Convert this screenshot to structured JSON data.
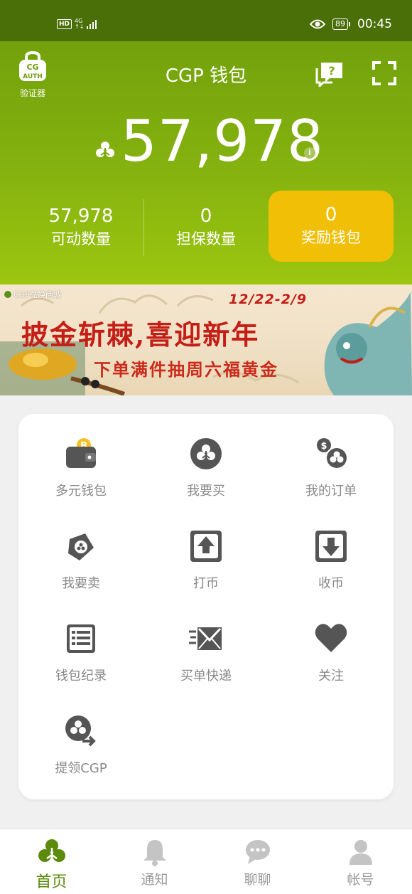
{
  "status_bar": {
    "hd": "HD",
    "network": "4G",
    "network_sub": "↑↓",
    "battery": "89",
    "time": "00:45"
  },
  "header": {
    "auth_label": "验证器",
    "auth_logo_text": "CG AUTH",
    "title": "CGP 钱包",
    "help_icon_text": "?",
    "balance": "57,978",
    "info_icon_text": "i",
    "stats": [
      {
        "value": "57,978",
        "label": "可动数量"
      },
      {
        "value": "0",
        "label": "担保数量"
      }
    ],
    "reward": {
      "value": "0",
      "label": "奖励钱包"
    },
    "colors": {
      "top": "#72a10c",
      "bottom": "#9cc60f",
      "reward": "#f2bf07"
    }
  },
  "banner": {
    "brand": "CGP兑换商城",
    "date_range": "12/22-2/9",
    "headline": "披金斩棘,喜迎新年",
    "subline": "下单满件抽周六福黄金"
  },
  "menu": {
    "items": [
      {
        "label": "多元钱包",
        "icon": "multi-wallet-icon"
      },
      {
        "label": "我要买",
        "icon": "buy-icon"
      },
      {
        "label": "我的订单",
        "icon": "orders-icon"
      },
      {
        "label": "我要卖",
        "icon": "sell-icon"
      },
      {
        "label": "打币",
        "icon": "send-coin-icon"
      },
      {
        "label": "收币",
        "icon": "receive-coin-icon"
      },
      {
        "label": "钱包纪录",
        "icon": "wallet-record-icon"
      },
      {
        "label": "买单快递",
        "icon": "express-mail-icon"
      },
      {
        "label": "关注",
        "icon": "heart-icon"
      },
      {
        "label": "提领CGP",
        "icon": "withdraw-icon"
      }
    ]
  },
  "tabs": [
    {
      "label": "首页",
      "icon": "home-clover-icon",
      "active": true
    },
    {
      "label": "通知",
      "icon": "bell-icon",
      "active": false
    },
    {
      "label": "聊聊",
      "icon": "chat-icon",
      "active": false
    },
    {
      "label": "帐号",
      "icon": "account-icon",
      "active": false
    }
  ]
}
